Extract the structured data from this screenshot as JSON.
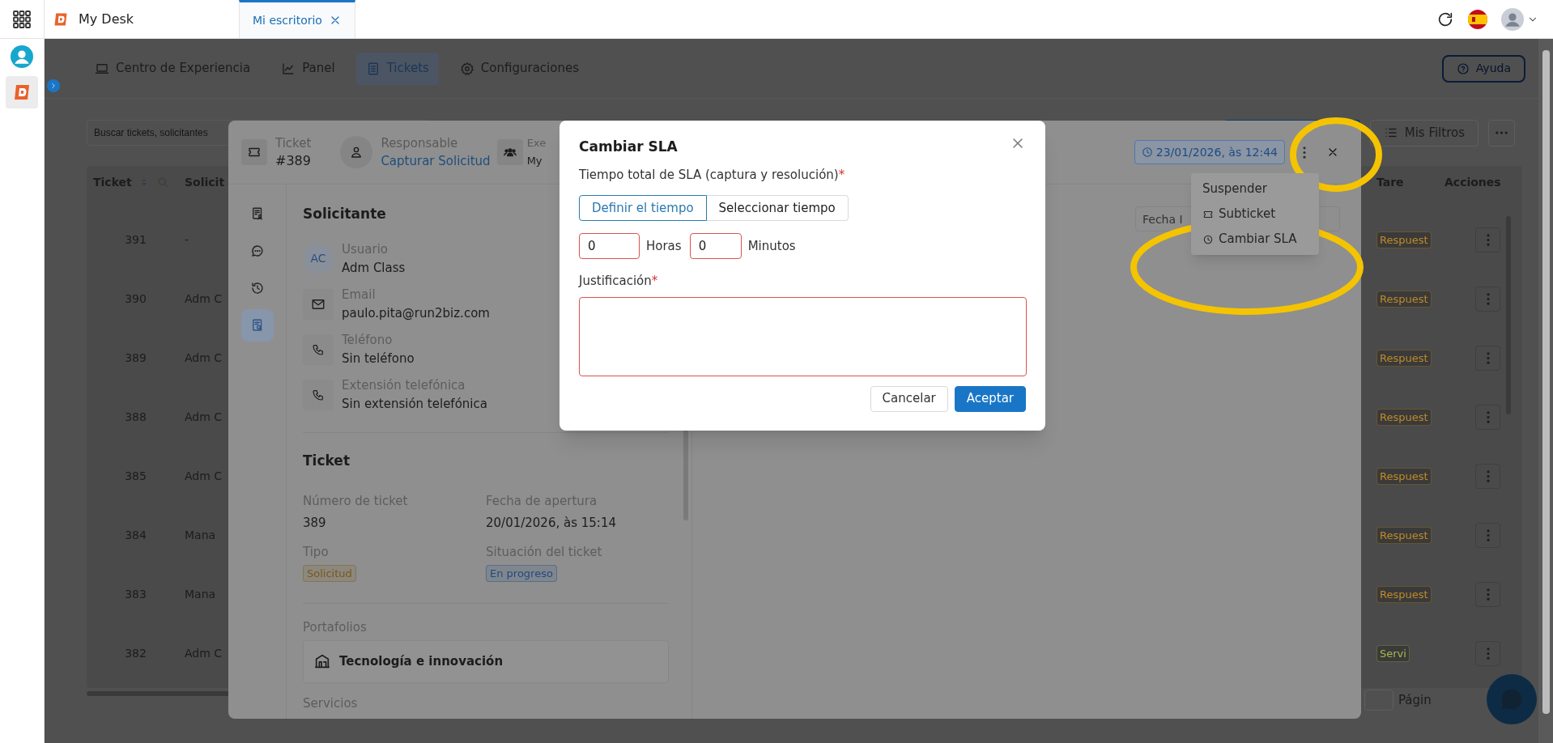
{
  "top_bar": {
    "app_title": "My Desk",
    "tabs": [
      {
        "label": "Mi escritorio",
        "selected": true
      }
    ]
  },
  "nav": {
    "items": [
      {
        "label": "Centro de Experiencia",
        "selected": false
      },
      {
        "label": "Panel",
        "selected": false
      },
      {
        "label": "Tickets",
        "selected": true
      },
      {
        "label": "Configuraciones",
        "selected": false
      }
    ],
    "help_button": "Ayuda"
  },
  "toolbar": {
    "search_placeholder": "Buscar tickets, solicitantes",
    "filters_button": "Mis Filtros"
  },
  "table": {
    "columns": [
      "Ticket",
      "Solicit",
      "Tare",
      "Acciones"
    ],
    "rows": [
      {
        "ticket": "391",
        "requester": "-",
        "task": "Respuest",
        "color": "#c08a28"
      },
      {
        "ticket": "390",
        "requester": "Adm C",
        "task": "Respuest",
        "color": "#c08a28"
      },
      {
        "ticket": "389",
        "requester": "Adm C",
        "task": "Respuest",
        "color": "#c08a28"
      },
      {
        "ticket": "388",
        "requester": "Adm C",
        "task": "Respuest",
        "color": "#c08a28"
      },
      {
        "ticket": "385",
        "requester": "Adm C",
        "task": "Respuest",
        "color": "#c08a28"
      },
      {
        "ticket": "384",
        "requester": "Mana",
        "task": "Respuest",
        "color": "#c08a28"
      },
      {
        "ticket": "383",
        "requester": "Mana",
        "task": "Respuest",
        "color": "#c08a28"
      },
      {
        "ticket": "382",
        "requester": "Adm C",
        "task": "Servi",
        "color": "#a9b84e"
      }
    ]
  },
  "pagination": {
    "label": "Págin"
  },
  "drawer": {
    "header": {
      "ticket_label": "Ticket",
      "ticket_number": "#389",
      "owner_label": "Responsable",
      "owner": "Capturar Solicitud",
      "group_label": "Exe",
      "group": "My",
      "due_date": "23/01/2026, às 12:44"
    },
    "tabs": [
      {
        "selected": false
      },
      {
        "selected": false
      },
      {
        "selected": false
      },
      {
        "selected": true
      }
    ],
    "requester": {
      "title": "Solicitante",
      "fields": [
        {
          "kind": "avatar",
          "initials": "AC",
          "label": "Usuario",
          "value": "Adm Class"
        },
        {
          "kind": "email",
          "label": "Email",
          "value": "paulo.pita@run2biz.com"
        },
        {
          "kind": "phone",
          "label": "Teléfono",
          "value": "Sin teléfono"
        },
        {
          "kind": "phone",
          "label": "Extensión telefónica",
          "value": "Sin extensión telefónica"
        }
      ]
    },
    "ticket": {
      "title": "Ticket",
      "fields": [
        {
          "kind": "text",
          "label": "Número de ticket",
          "value": "389"
        },
        {
          "kind": "text",
          "label": "Fecha de apertura",
          "value": "20/01/2026, às 15:14"
        },
        {
          "kind": "badge",
          "label": "Tipo",
          "value": "Solicitud",
          "color": "#7a5714"
        },
        {
          "kind": "badge",
          "label": "Situación del ticket",
          "value": "En progreso",
          "color": "#1f4a80"
        }
      ]
    },
    "portfolio": {
      "label": "Portafolios",
      "value": "Tecnología e innovación"
    },
    "services_label": "Servicios",
    "date_filter": {
      "placeholder": "Fecha I"
    }
  },
  "menu": {
    "items": [
      {
        "label": "Suspender"
      },
      {
        "label": "Subticket"
      },
      {
        "label": "Cambiar SLA"
      }
    ]
  },
  "modal": {
    "title": "Cambiar SLA",
    "time_label": "Tiempo total de SLA (captura y resolución)",
    "required_mark": "*",
    "modes": [
      {
        "label": "Definir el tiempo",
        "selected": true
      },
      {
        "label": "Seleccionar tiempo",
        "selected": false
      }
    ],
    "inputs": [
      {
        "value": "0",
        "unit": "Horas",
        "invalid": true
      },
      {
        "value": "0",
        "unit": "Minutos",
        "invalid": true
      }
    ],
    "justification": {
      "label": "Justificación",
      "required_mark": "*",
      "invalid": true
    },
    "buttons": [
      {
        "kind": "secondary",
        "label": "Cancelar"
      },
      {
        "kind": "primary",
        "label": "Aceptar"
      }
    ]
  }
}
